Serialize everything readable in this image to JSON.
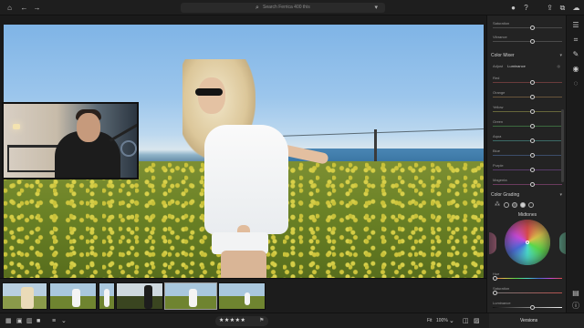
{
  "topbar": {
    "search_placeholder": "Search Ferrica 400 this",
    "icons": [
      "home-icon",
      "back-icon",
      "forward-icon",
      "search-icon",
      "filter-icon",
      "cloud-sync-icon",
      "help-icon",
      "share-icon",
      "new-window-icon",
      "cloud-icon"
    ]
  },
  "panel": {
    "top_sliders": [
      {
        "label": "Saturation",
        "value": 0
      },
      {
        "label": "Vibrance",
        "value": 0
      }
    ],
    "color_mixer": {
      "title": "Color Mixer",
      "adjust_label": "Adjust",
      "adjust_value": "Luminance",
      "channels": [
        "Red",
        "Orange",
        "Yellow",
        "Green",
        "Aqua",
        "Blue",
        "Purple",
        "Magenta"
      ]
    },
    "color_grading": {
      "title": "Color Grading",
      "wheel_label": "Midtones",
      "sliders": [
        "Hue",
        "Saturation",
        "Luminance"
      ]
    }
  },
  "filmstrip": {
    "thumb_count": 6,
    "selected_index": 4
  },
  "bottombar": {
    "stars": "★★★★★",
    "fit_label": "Fit",
    "zoom_label": "100%",
    "versions_label": "Versions"
  },
  "colors": {
    "background": "#161616",
    "panel": "#232323",
    "accent": "#cfcfcf"
  }
}
